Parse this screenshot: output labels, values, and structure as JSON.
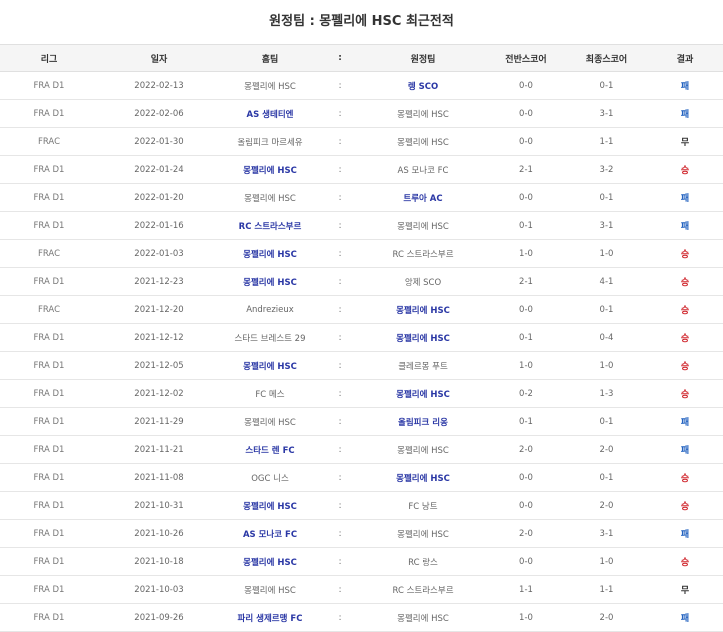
{
  "title": "원정팀 : 몽펠리에 HSC 최근전적",
  "headers": [
    "리그",
    "일자",
    "홈팀",
    ":",
    "원정팀",
    "전반스코어",
    "최종스코어",
    "결과"
  ],
  "colors": {
    "win": "#d0252c",
    "loss": "#1e5fbf",
    "draw": "#333333",
    "team_highlight": "#2a37a5"
  },
  "rows": [
    {
      "league": "FRA D1",
      "date": "2022-02-13",
      "home": "몽펠리에 HSC",
      "sep": ":",
      "away": "렝 SCO",
      "half": "0-0",
      "final": "0-1",
      "result": "패",
      "winner": "away",
      "res": "L"
    },
    {
      "league": "FRA D1",
      "date": "2022-02-06",
      "home": "AS 생테티엔",
      "sep": ":",
      "away": "몽펠리에 HSC",
      "half": "0-0",
      "final": "3-1",
      "result": "패",
      "winner": "home",
      "res": "L"
    },
    {
      "league": "FRAC",
      "date": "2022-01-30",
      "home": "올림피크 마르세유",
      "sep": ":",
      "away": "몽펠리에 HSC",
      "half": "0-0",
      "final": "1-1",
      "result": "무",
      "winner": "",
      "res": "D"
    },
    {
      "league": "FRA D1",
      "date": "2022-01-24",
      "home": "몽펠리에 HSC",
      "sep": ":",
      "away": "AS 모나코 FC",
      "half": "2-1",
      "final": "3-2",
      "result": "승",
      "winner": "home",
      "res": "W"
    },
    {
      "league": "FRA D1",
      "date": "2022-01-20",
      "home": "몽펠리에 HSC",
      "sep": ":",
      "away": "트루아 AC",
      "half": "0-0",
      "final": "0-1",
      "result": "패",
      "winner": "away",
      "res": "L"
    },
    {
      "league": "FRA D1",
      "date": "2022-01-16",
      "home": "RC 스트라스부르",
      "sep": ":",
      "away": "몽펠리에 HSC",
      "half": "0-1",
      "final": "3-1",
      "result": "패",
      "winner": "home",
      "res": "L"
    },
    {
      "league": "FRAC",
      "date": "2022-01-03",
      "home": "몽펠리에 HSC",
      "sep": ":",
      "away": "RC 스트라스부르",
      "half": "1-0",
      "final": "1-0",
      "result": "승",
      "winner": "home",
      "res": "W"
    },
    {
      "league": "FRA D1",
      "date": "2021-12-23",
      "home": "몽펠리에 HSC",
      "sep": ":",
      "away": "앙제 SCO",
      "half": "2-1",
      "final": "4-1",
      "result": "승",
      "winner": "home",
      "res": "W"
    },
    {
      "league": "FRAC",
      "date": "2021-12-20",
      "home": "Andrezieux",
      "sep": ":",
      "away": "몽펠리에 HSC",
      "half": "0-0",
      "final": "0-1",
      "result": "승",
      "winner": "away",
      "res": "W"
    },
    {
      "league": "FRA D1",
      "date": "2021-12-12",
      "home": "스타드 브레스트 29",
      "sep": ":",
      "away": "몽펠리에 HSC",
      "half": "0-1",
      "final": "0-4",
      "result": "승",
      "winner": "away",
      "res": "W"
    },
    {
      "league": "FRA D1",
      "date": "2021-12-05",
      "home": "몽펠리에 HSC",
      "sep": ":",
      "away": "클레르몽 푸트",
      "half": "1-0",
      "final": "1-0",
      "result": "승",
      "winner": "home",
      "res": "W"
    },
    {
      "league": "FRA D1",
      "date": "2021-12-02",
      "home": "FC 메스",
      "sep": ":",
      "away": "몽펠리에 HSC",
      "half": "0-2",
      "final": "1-3",
      "result": "승",
      "winner": "away",
      "res": "W"
    },
    {
      "league": "FRA D1",
      "date": "2021-11-29",
      "home": "몽펠리에 HSC",
      "sep": ":",
      "away": "올림피크 리옹",
      "half": "0-1",
      "final": "0-1",
      "result": "패",
      "winner": "away",
      "res": "L"
    },
    {
      "league": "FRA D1",
      "date": "2021-11-21",
      "home": "스타드 렌 FC",
      "sep": ":",
      "away": "몽펠리에 HSC",
      "half": "2-0",
      "final": "2-0",
      "result": "패",
      "winner": "home",
      "res": "L"
    },
    {
      "league": "FRA D1",
      "date": "2021-11-08",
      "home": "OGC 니스",
      "sep": ":",
      "away": "몽펠리에 HSC",
      "half": "0-0",
      "final": "0-1",
      "result": "승",
      "winner": "away",
      "res": "W"
    },
    {
      "league": "FRA D1",
      "date": "2021-10-31",
      "home": "몽펠리에 HSC",
      "sep": ":",
      "away": "FC 낭트",
      "half": "0-0",
      "final": "2-0",
      "result": "승",
      "winner": "home",
      "res": "W"
    },
    {
      "league": "FRA D1",
      "date": "2021-10-26",
      "home": "AS 모나코 FC",
      "sep": ":",
      "away": "몽펠리에 HSC",
      "half": "2-0",
      "final": "3-1",
      "result": "패",
      "winner": "home",
      "res": "L"
    },
    {
      "league": "FRA D1",
      "date": "2021-10-18",
      "home": "몽펠리에 HSC",
      "sep": ":",
      "away": "RC 랑스",
      "half": "0-0",
      "final": "1-0",
      "result": "승",
      "winner": "home",
      "res": "W"
    },
    {
      "league": "FRA D1",
      "date": "2021-10-03",
      "home": "몽펠리에 HSC",
      "sep": ":",
      "away": "RC 스트라스부르",
      "half": "1-1",
      "final": "1-1",
      "result": "무",
      "winner": "",
      "res": "D"
    },
    {
      "league": "FRA D1",
      "date": "2021-09-26",
      "home": "파리 생제르맹 FC",
      "sep": ":",
      "away": "몽펠리에 HSC",
      "half": "1-0",
      "final": "2-0",
      "result": "패",
      "winner": "home",
      "res": "L"
    }
  ]
}
